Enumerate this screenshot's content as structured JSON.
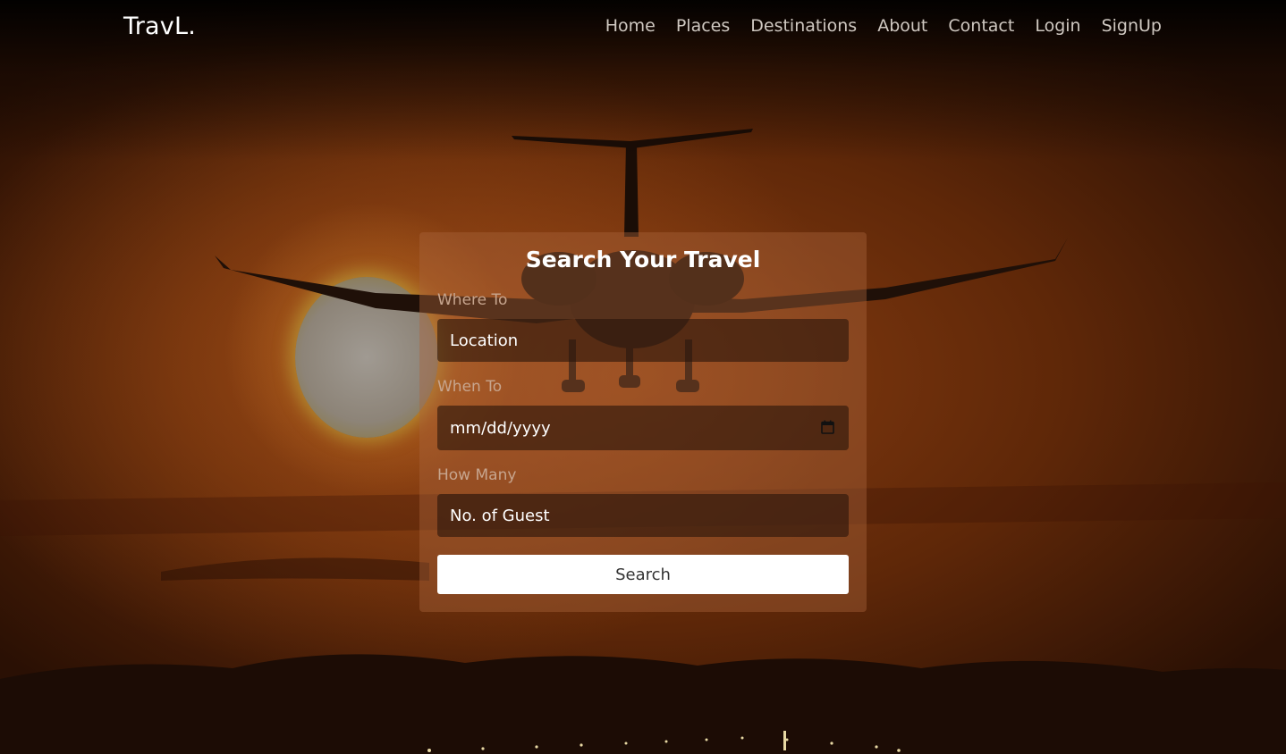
{
  "navbar": {
    "brand": "TravL.",
    "links": [
      "Home",
      "Places",
      "Destinations",
      "About",
      "Contact",
      "Login",
      "SignUp"
    ]
  },
  "search_card": {
    "title": "Search Your Travel",
    "where": {
      "label": "Where To",
      "placeholder": "Location"
    },
    "when": {
      "label": "When To",
      "placeholder": "mm/dd/yyyy"
    },
    "guests": {
      "label": "How Many",
      "placeholder": "No. of Guest"
    },
    "button": "Search"
  },
  "colors": {
    "card_bg": "#aa643c",
    "input_bg": "#28140a",
    "label": "#c7a58e",
    "button_bg": "#ffffff"
  }
}
